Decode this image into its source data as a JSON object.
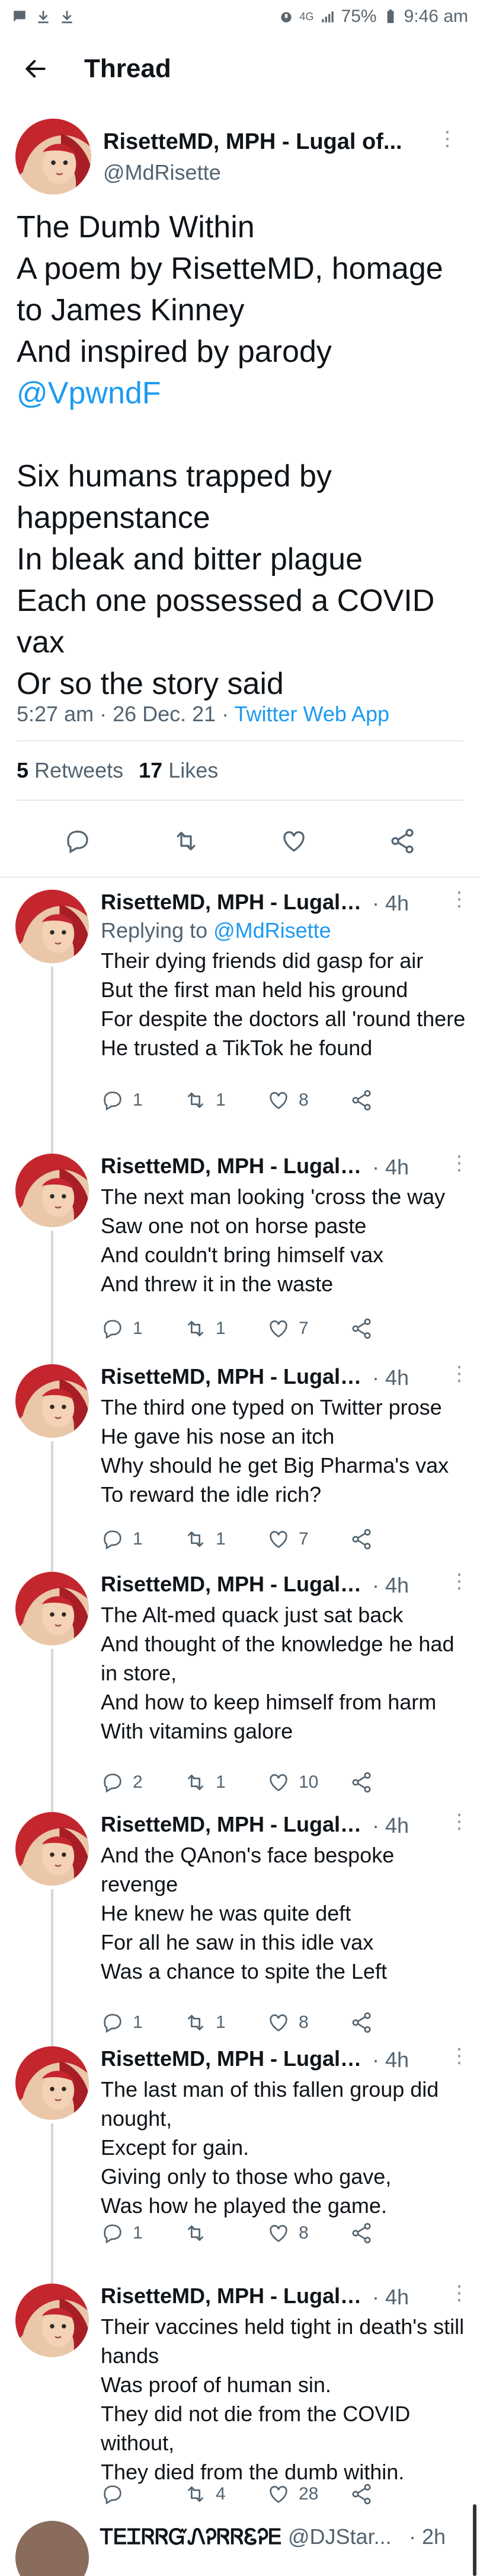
{
  "statusbar": {
    "network": "4G",
    "battery": "75%",
    "time": "9:46 am",
    "left_icons": [
      "chat-bubble-icon",
      "download-icon",
      "download-icon"
    ]
  },
  "header": {
    "title": "Thread"
  },
  "main_tweet": {
    "name": "RisetteMD, MPH - Lugal of...",
    "handle": "@MdRisette",
    "text_before": "The Dumb Within\nA poem by RisetteMD, homage to James Kinney\nAnd inspired by parody\n",
    "mention": "@VpwndF",
    "text_after": "\n\nSix humans trapped by happenstance\nIn bleak and bitter plague\nEach one possessed a COVID vax\nOr so the story said",
    "timestamp": "5:27 am · 26 Dec. 21 · ",
    "source": "Twitter Web App",
    "retweets_count": "5",
    "retweets_label": "Retweets",
    "likes_count": "17",
    "likes_label": "Likes"
  },
  "replies": [
    {
      "name": "RisetteMD, MPH - Lugal o...",
      "time": "· 4h",
      "replying_prefix": "Replying to ",
      "replying_handle": "@MdRisette",
      "text": "Their dying friends did gasp for air\nBut the first man held his ground\nFor despite the doctors all 'round there\nHe trusted a TikTok he found",
      "replies": "1",
      "retweets": "1",
      "likes": "8"
    },
    {
      "name": "RisetteMD, MPH - Lugal o...",
      "time": "· 4h",
      "text": "The next man looking 'cross the way\nSaw one not on horse paste\nAnd couldn't bring himself vax\nAnd threw it in the waste",
      "replies": "1",
      "retweets": "1",
      "likes": "7"
    },
    {
      "name": "RisetteMD, MPH - Lugal o...",
      "time": "· 4h",
      "text": "The third one typed on Twitter prose\nHe gave his nose an itch\nWhy should he get Big Pharma's vax\nTo reward the idle rich?",
      "replies": "1",
      "retweets": "1",
      "likes": "7"
    },
    {
      "name": "RisetteMD, MPH - Lugal o...",
      "time": "· 4h",
      "text": "The Alt-med quack just sat back\nAnd thought of the knowledge he had in store,\nAnd how to keep himself from harm\nWith vitamins galore",
      "replies": "2",
      "retweets": "1",
      "likes": "10"
    },
    {
      "name": "RisetteMD, MPH - Lugal o...",
      "time": "· 4h",
      "text": "And the QAnon's face bespoke revenge\nHe knew he was quite deft\nFor all he saw in this idle vax\nWas a chance to spite the Left",
      "replies": "1",
      "retweets": "1",
      "likes": "8"
    },
    {
      "name": "RisetteMD, MPH - Lugal o...",
      "time": "· 4h",
      "text": "The last man of this fallen group did nought,\nExcept for gain.\nGiving only to those who gave,\nWas how he played the game.",
      "replies": "1",
      "retweets": "",
      "likes": "8"
    },
    {
      "name": "RisetteMD, MPH - Lugal o...",
      "time": "· 4h",
      "text": "Their vaccines held tight in death's still hands\nWas proof of human sin.\nThey did not die from the COVID without,\nThey died from the dumb within.",
      "replies": "",
      "retweets": "4",
      "likes": "28"
    }
  ],
  "next_item": {
    "name": "ᎢᎬᏆᏒᏒᏳᏁᎮᏒᏒᏋᎮᎬ",
    "handle": "@DJStar...",
    "time": "· 2h"
  },
  "colors": {
    "accent": "#1d9bf0",
    "muted": "#536471",
    "text": "#0f1419"
  }
}
